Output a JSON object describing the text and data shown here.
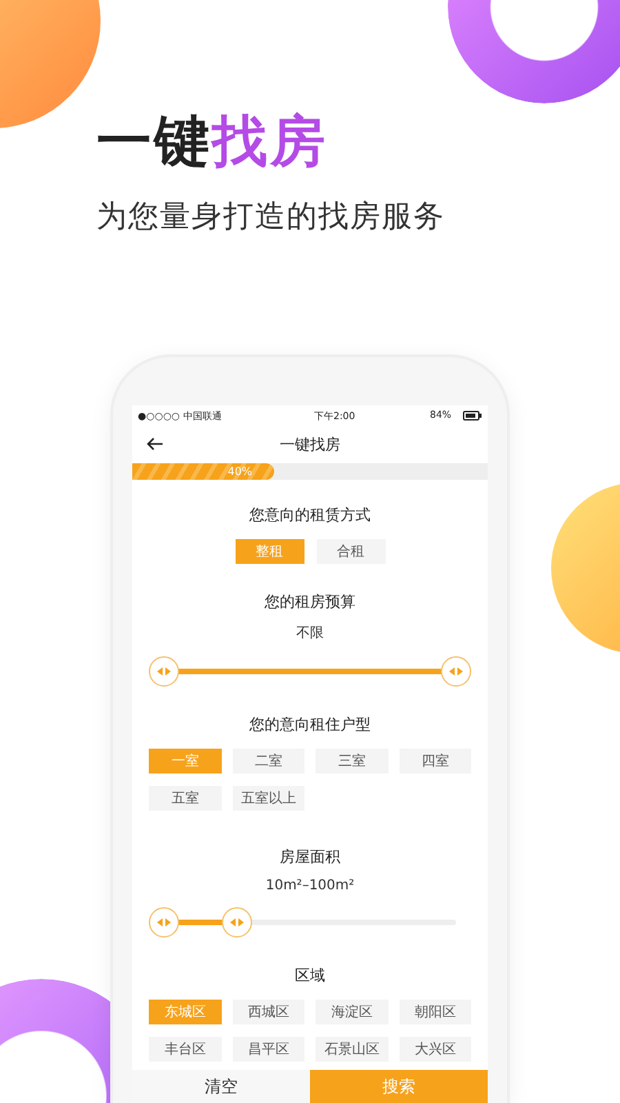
{
  "headline": {
    "plain": "一键",
    "accent": "找房"
  },
  "subtitle": "为您量身打造的找房服务",
  "status_bar": {
    "carrier": "●○○○○ 中国联通",
    "time": "下午2:00",
    "battery": "84%"
  },
  "nav": {
    "title": "一键找房"
  },
  "progress": {
    "level": 0.4,
    "label": "40%"
  },
  "sections": [
    {
      "kind": "toggle",
      "title": "您意向的租赁方式",
      "options": [
        {
          "label": "整租",
          "selected": true
        },
        {
          "label": "合租",
          "selected": false
        }
      ]
    },
    {
      "kind": "range",
      "title": "您的租房预算",
      "value": "不限",
      "thumbs": [
        {
          "level": 0
        },
        {
          "level": 1
        }
      ]
    },
    {
      "kind": "grid",
      "title": "您的意向租住户型",
      "options": [
        {
          "label": "一室",
          "selected": true
        },
        {
          "label": "二室",
          "selected": false
        },
        {
          "label": "三室",
          "selected": false
        },
        {
          "label": "四室",
          "selected": false
        },
        {
          "label": "五室",
          "selected": false
        },
        {
          "label": "五室以上",
          "selected": false
        }
      ]
    },
    {
      "kind": "range",
      "title": "房屋面积",
      "value": "10m²–100m²",
      "thumbs": [
        {
          "level": 0
        },
        {
          "level": 0.25
        }
      ]
    },
    {
      "kind": "grid",
      "title": "区域",
      "options": [
        {
          "label": "东城区",
          "selected": true
        },
        {
          "label": "西城区",
          "selected": false
        },
        {
          "label": "海淀区",
          "selected": false
        },
        {
          "label": "朝阳区",
          "selected": false
        },
        {
          "label": "丰台区",
          "selected": false
        },
        {
          "label": "昌平区",
          "selected": false
        },
        {
          "label": "石景山区",
          "selected": false
        },
        {
          "label": "大兴区",
          "selected": false
        }
      ]
    }
  ],
  "buttons": [
    {
      "label": "清空",
      "kind": "secondary"
    },
    {
      "label": "搜索",
      "kind": "primary"
    }
  ]
}
